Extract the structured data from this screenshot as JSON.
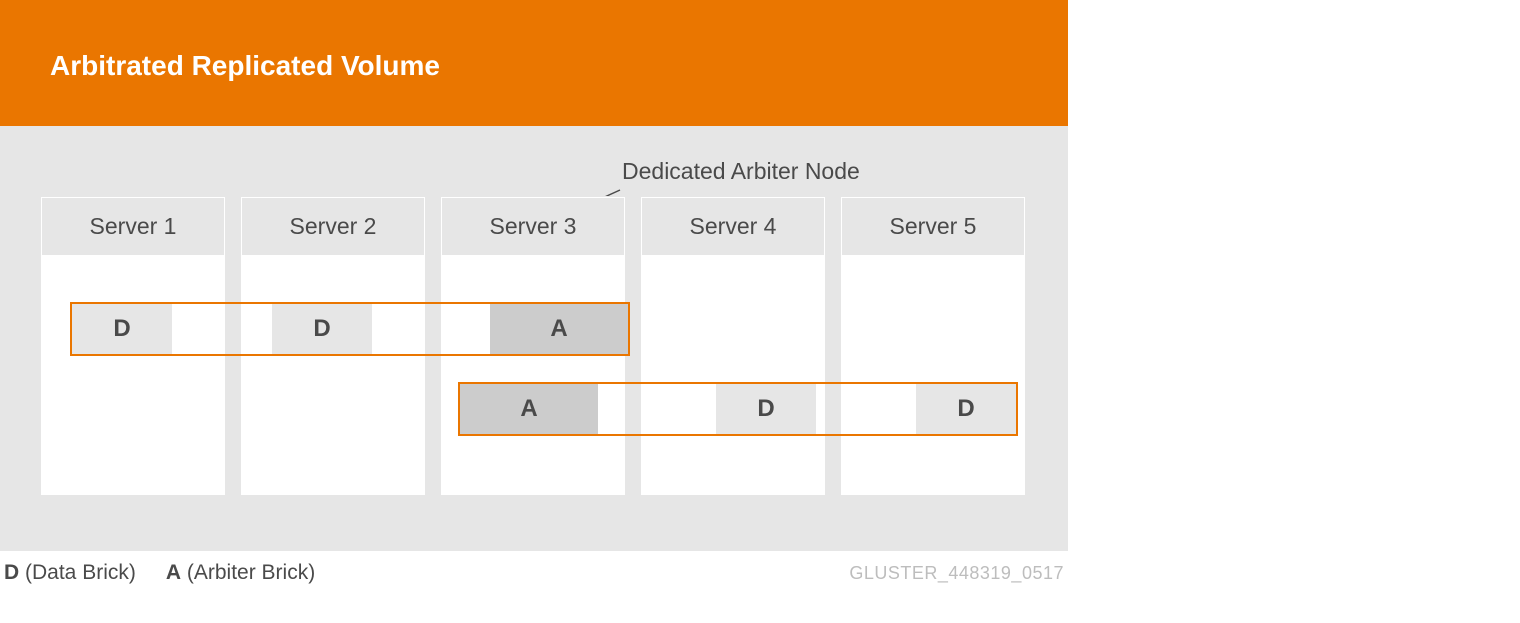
{
  "title": "Arbitrated Replicated Volume",
  "annotation": "Dedicated Arbiter Node",
  "servers": [
    {
      "label": "Server 1"
    },
    {
      "label": "Server 2"
    },
    {
      "label": "Server 3"
    },
    {
      "label": "Server 4"
    },
    {
      "label": "Server 5"
    }
  ],
  "bricks": {
    "D": "D",
    "A": "A"
  },
  "legend": {
    "d_symbol": "D",
    "d_label": " (Data Brick)",
    "a_symbol": "A",
    "a_label": " (Arbiter Brick)"
  },
  "doc_id": "GLUSTER_448319_0517",
  "colors": {
    "accent": "#ea7600",
    "bg_gray": "#e6e6e6",
    "brick_arbiter": "#cccccc",
    "text": "#4a4a4a"
  }
}
